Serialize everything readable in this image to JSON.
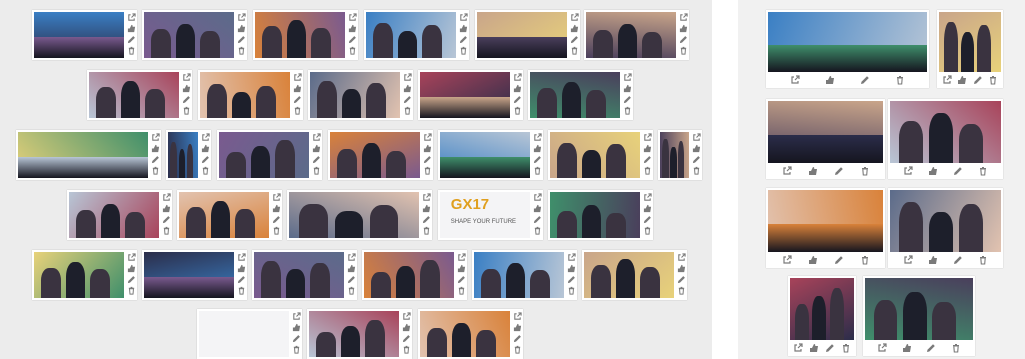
{
  "theme": {
    "left_bg": "#ececec",
    "right_bg": "#f1f1f1",
    "icon_color": "#7a7a7a",
    "palette": [
      "#2b2d4a",
      "#7a5a8f",
      "#d9823a",
      "#3a7fc4",
      "#c9a58a",
      "#4a3f5c",
      "#b8c6d6",
      "#e2c3b0",
      "#5b6b8a",
      "#a8435a",
      "#3f8f6b",
      "#e8d27a"
    ]
  },
  "actions": [
    "open-icon",
    "like-icon",
    "edit-icon",
    "delete-icon"
  ],
  "gallery_photos": [
    {
      "scene": "audience"
    },
    {
      "scene": "people"
    },
    {
      "scene": "stand"
    },
    {
      "scene": "people"
    },
    {
      "scene": "stage"
    },
    {
      "scene": "people"
    },
    {
      "scene": "people"
    },
    {
      "scene": "banner"
    },
    {
      "scene": "banner"
    },
    {
      "scene": "stage"
    },
    {
      "scene": "people"
    },
    {
      "scene": "stage"
    },
    {
      "scene": "people"
    },
    {
      "scene": "people"
    },
    {
      "scene": "people"
    },
    {
      "scene": "stage"
    },
    {
      "scene": "people"
    },
    {
      "scene": "people"
    },
    {
      "scene": "people"
    },
    {
      "scene": "people"
    },
    {
      "scene": "people"
    },
    {
      "scene": "logo",
      "caption": "GX17",
      "tagline": "SHAPE YOUR FUTURE"
    },
    {
      "scene": "people"
    },
    {
      "scene": "people"
    },
    {
      "scene": "stage"
    },
    {
      "scene": "people"
    },
    {
      "scene": "people"
    },
    {
      "scene": "people"
    },
    {
      "scene": "people"
    },
    {
      "scene": "logo"
    },
    {
      "scene": "people"
    },
    {
      "scene": "people"
    }
  ],
  "selected_photos": [
    {
      "scene": "audience"
    },
    {
      "scene": "people"
    },
    {
      "scene": "stage"
    },
    {
      "scene": "people"
    },
    {
      "scene": "stage"
    },
    {
      "scene": "people"
    },
    {
      "scene": "people"
    },
    {
      "scene": "people"
    }
  ]
}
